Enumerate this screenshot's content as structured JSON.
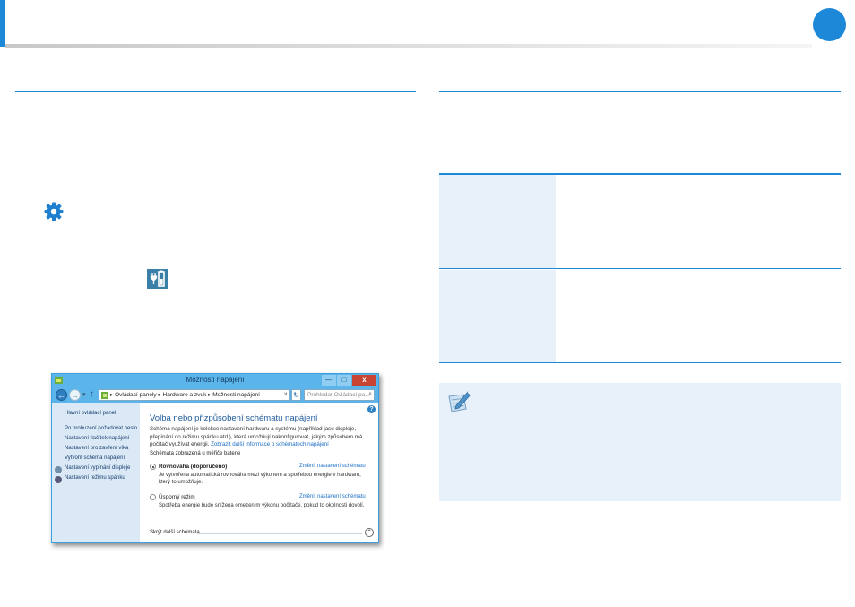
{
  "header": {
    "accent_color": "#1e88d8"
  },
  "window": {
    "title": "Možnosti napájení",
    "buttons": {
      "minimize": "—",
      "maximize": "□",
      "close": "x"
    },
    "nav": {
      "back": "←",
      "forward": "→",
      "history": "▾",
      "up": "↑",
      "address": "▸ Ovládací panely ▸ Hardware a zvuk ▸ Možnosti napájení",
      "address_dropdown": "∨",
      "refresh": "↻",
      "search_placeholder": "Prohledat Ovládací pa...",
      "search_icon": "⌕"
    },
    "sidebar": {
      "items": [
        "Hlavní ovládací panel",
        "Po probuzení požadovat heslo",
        "Nastavení tlačítek napájení",
        "Nastavení pro zavření víka",
        "Vytvořit schéma napájení",
        "Nastavení vypínání displeje",
        "Nastavení režimu spánku"
      ]
    },
    "main": {
      "help": "?",
      "heading": "Volba nebo přizpůsobení schématu napájení",
      "description": "Schéma napájení je kolekce nastavení hardwaru a systému (například jasu displeje, přepínání do režimu spánku atd.), která umožňují nakonfigurovat, jakým způsobem má počítač využívat energii.",
      "description_link": "Zobrazit další informace o schématech napájení",
      "group_label": "Schémata zobrazená u měřiče baterie",
      "plans": [
        {
          "name": "Rovnováha (doporučeno)",
          "selected": true,
          "link": "Změnit nastavení schématu",
          "description": "Je vytvořena automatická rovnováha mezi výkonem a spotřebou energie v hardwaru, který to umožňuje."
        },
        {
          "name": "Úsporný režim",
          "selected": false,
          "link": "Změnit nastavení schématu",
          "description": "Spotřeba energie bude snížena omezením výkonu počítače, pokud to okolnosti dovolí."
        }
      ],
      "hide_label": "Skrýt další schémata",
      "collapse_symbol": "⌃"
    }
  }
}
